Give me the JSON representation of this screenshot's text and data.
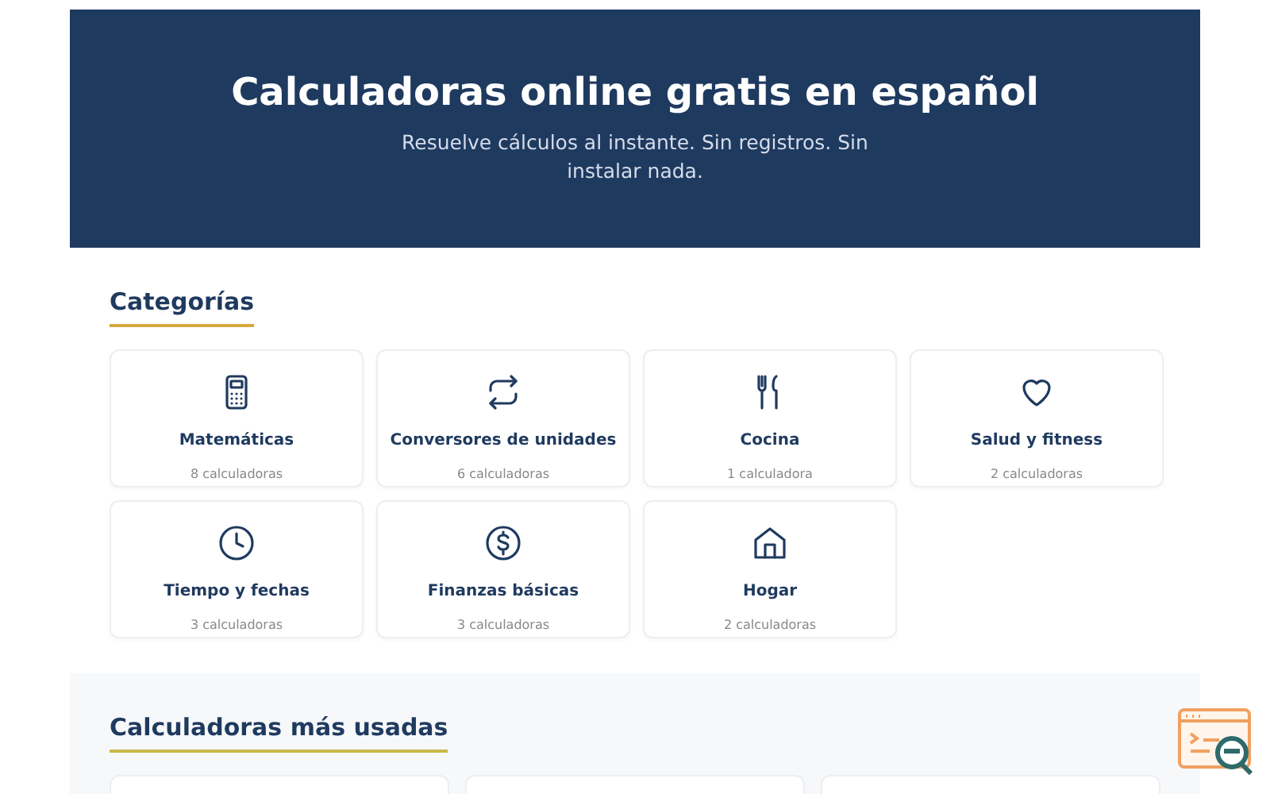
{
  "hero": {
    "title": "Calculadoras online gratis en español",
    "subtitle": "Resuelve cálculos al instante. Sin registros. Sin instalar nada."
  },
  "categories": {
    "heading": "Categorías",
    "items": [
      {
        "name": "Matemáticas",
        "count": "8 calculadoras"
      },
      {
        "name": "Conversores de unidades",
        "count": "6 calculadoras"
      },
      {
        "name": "Cocina",
        "count": "1 calculadora"
      },
      {
        "name": "Salud y fitness",
        "count": "2 calculadoras"
      },
      {
        "name": "Tiempo y fechas",
        "count": "3 calculadoras"
      },
      {
        "name": "Finanzas básicas",
        "count": "3 calculadoras"
      },
      {
        "name": "Hogar",
        "count": "2 calculadoras"
      }
    ]
  },
  "popular": {
    "heading": "Calculadoras más usadas"
  }
}
